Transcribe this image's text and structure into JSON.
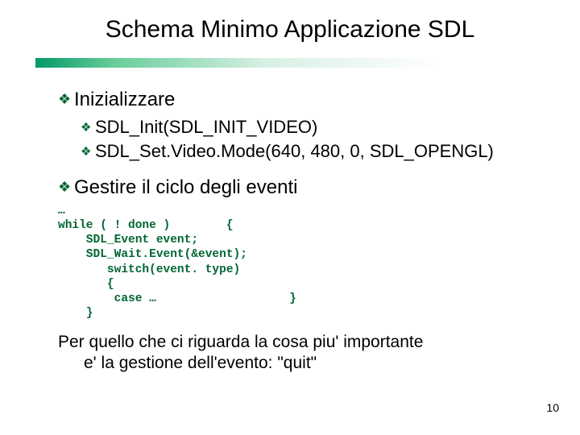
{
  "title": "Schema Minimo Applicazione SDL",
  "section1": {
    "heading": "Inizializzare",
    "items": [
      "SDL_Init(SDL_INIT_VIDEO)",
      "SDL_Set.Video.Mode(640, 480, 0, SDL_OPENGL)"
    ]
  },
  "section2": {
    "heading": "Gestire il ciclo degli eventi",
    "code": "…\nwhile ( ! done )        {\n    SDL_Event event;\n    SDL_Wait.Event(&event);\n       switch(event. type)\n       {\n        case …                   }\n    }"
  },
  "closing": {
    "line1": "Per quello che ci riguarda la cosa piu' importante",
    "line2": "e' la gestione dell'evento: \"quit\""
  },
  "page_number": "10"
}
